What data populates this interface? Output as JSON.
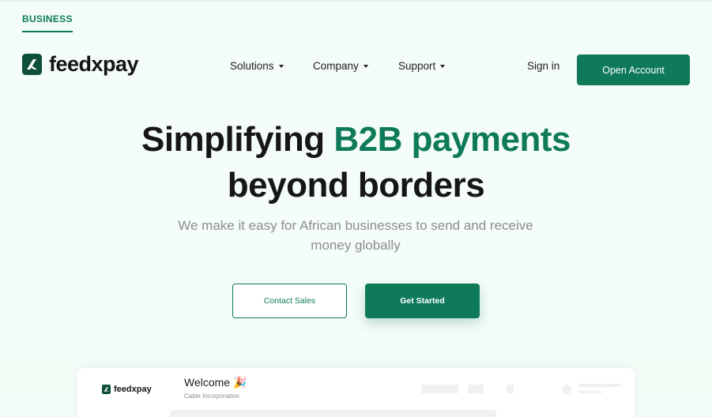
{
  "header": {
    "business_tab": "BUSINESS",
    "logo_text": "feedxpay",
    "nav": [
      {
        "label": "Solutions"
      },
      {
        "label": "Company"
      },
      {
        "label": "Support"
      }
    ],
    "sign_in": "Sign in",
    "open_account": "Open Account"
  },
  "hero": {
    "title_part1": "Simplifying ",
    "title_accent": "B2B payments",
    "title_line2": "beyond borders",
    "subtitle": "We make it easy for African businesses to send and receive money globally",
    "contact_sales": "Contact Sales",
    "get_started": "Get Started"
  },
  "dashboard_preview": {
    "logo_text": "feedxpay",
    "welcome": "Welcome 🎉",
    "company": "Cable Incorporation"
  },
  "colors": {
    "brand_green": "#0e7a5a",
    "text_dark": "#161616",
    "subtitle_gray": "#8a8f8d"
  },
  "icons": {
    "logo": "feedxpay-logo-icon",
    "nav_caret": "caret-down-icon"
  }
}
